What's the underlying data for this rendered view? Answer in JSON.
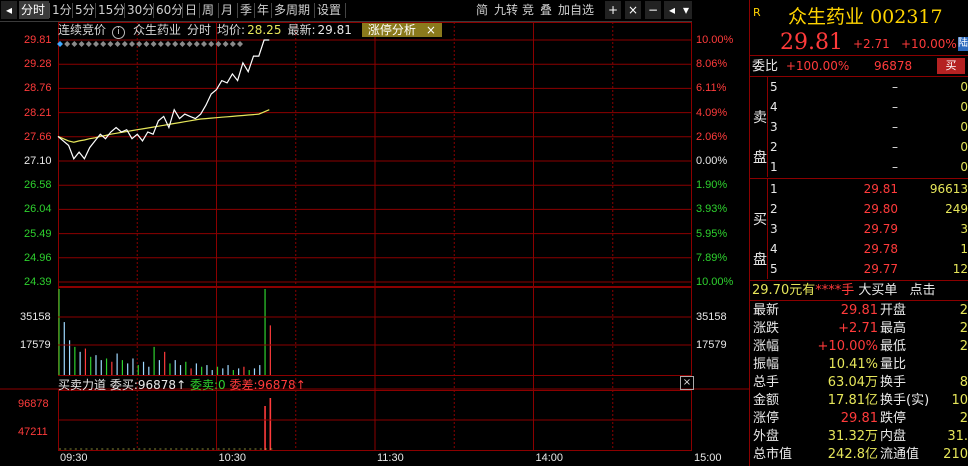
{
  "toolbar": {
    "periods": [
      {
        "label": "分时",
        "active": true
      },
      {
        "label": "1分",
        "active": false
      },
      {
        "label": "5分",
        "active": false
      },
      {
        "label": "15分",
        "active": false
      },
      {
        "label": "30分",
        "active": false
      },
      {
        "label": "60分",
        "active": false
      },
      {
        "label": "日",
        "active": false
      },
      {
        "label": "周",
        "active": false
      },
      {
        "label": "月",
        "active": false
      },
      {
        "label": "季",
        "active": false
      },
      {
        "label": "年",
        "active": false
      },
      {
        "label": "多周期",
        "active": false
      },
      {
        "label": "设置",
        "active": false
      }
    ],
    "right_buttons": [
      "简",
      "九转",
      "竞",
      "叠",
      "加自选"
    ],
    "controls": [
      "+",
      "×",
      "−"
    ]
  },
  "info_bar": {
    "auction_label": "连续竞价",
    "info_icon": "info-icon",
    "stock_name": "众生药业",
    "mode": "分时",
    "avg_label": "均价:",
    "avg_value": "28.25",
    "latest_label": "最新:",
    "latest_value": "29.81",
    "tag": "涨停分析",
    "tag_close": "×"
  },
  "price_axis": {
    "left": [
      "29.81",
      "29.28",
      "28.76",
      "28.21",
      "27.66",
      "27.10",
      "26.58",
      "26.04",
      "25.49",
      "24.96",
      "24.39"
    ],
    "right": [
      "10.00%",
      "8.06%",
      "6.11%",
      "4.09%",
      "2.06%",
      "0.00%",
      "1.90%",
      "3.93%",
      "5.95%",
      "7.89%",
      "10.00%"
    ]
  },
  "volume_axis": {
    "left": [
      "35158",
      "17579"
    ],
    "right": [
      "35158",
      "17579"
    ]
  },
  "force_panel": {
    "title": "买卖力道",
    "buy_label": "委买:",
    "buy_value": "96878↑",
    "sell_label": "委卖:",
    "sell_value": "0",
    "diff_label": "委差:",
    "diff_value": "96878↑",
    "close": "×",
    "axis": [
      "96878",
      "47211"
    ]
  },
  "time_axis": [
    "09:30",
    "10:30",
    "11:30",
    "14:00",
    "15:00"
  ],
  "chart_data": {
    "type": "line",
    "prev_close": 27.1,
    "price_times": [
      0,
      2,
      4,
      6,
      8,
      10,
      12,
      14,
      16,
      18,
      20,
      22,
      24,
      26,
      28,
      30,
      32,
      34,
      36,
      38,
      40,
      42,
      44,
      46,
      48,
      50,
      52,
      54,
      56,
      58,
      60,
      62,
      64,
      66,
      68,
      70,
      72,
      74,
      76,
      78,
      80
    ],
    "price": [
      27.65,
      27.55,
      27.45,
      27.15,
      27.3,
      27.15,
      27.4,
      27.55,
      27.7,
      27.6,
      27.75,
      27.85,
      27.75,
      27.8,
      27.6,
      27.7,
      27.55,
      27.75,
      27.7,
      28.0,
      28.1,
      27.85,
      28.25,
      28.05,
      28.15,
      28.1,
      28.05,
      28.15,
      28.35,
      28.6,
      28.7,
      28.9,
      28.85,
      29.05,
      28.9,
      29.3,
      29.1,
      29.45,
      29.45,
      29.81,
      29.81
    ],
    "avg": [
      27.65,
      27.6,
      27.55,
      27.52,
      27.55,
      27.57,
      27.6,
      27.62,
      27.65,
      27.67,
      27.7,
      27.72,
      27.74,
      27.76,
      27.78,
      27.8,
      27.82,
      27.84,
      27.86,
      27.88,
      27.9,
      27.92,
      27.94,
      27.96,
      27.98,
      28.0,
      28.02,
      28.04,
      28.05,
      28.06,
      28.07,
      28.08,
      28.09,
      28.1,
      28.11,
      28.12,
      28.13,
      28.14,
      28.15,
      28.2,
      28.25
    ],
    "volume_times": [
      0,
      2,
      4,
      6,
      8,
      10,
      12,
      14,
      16,
      18,
      20,
      22,
      24,
      26,
      28,
      30,
      32,
      34,
      36,
      38,
      40,
      42,
      44,
      46,
      48,
      50,
      52,
      54,
      56,
      58,
      60,
      62,
      64,
      66,
      68,
      70,
      72,
      74,
      76,
      78,
      80
    ],
    "volume": [
      52000,
      32000,
      21000,
      17000,
      14000,
      16000,
      11000,
      12000,
      9000,
      10000,
      8000,
      13000,
      9000,
      7000,
      10000,
      6000,
      8000,
      5000,
      17000,
      9000,
      14000,
      7000,
      9000,
      6000,
      8000,
      4000,
      7000,
      5000,
      6000,
      3000,
      5000,
      4000,
      6000,
      3000,
      4000,
      5000,
      3000,
      4000,
      6000,
      52000,
      30000
    ],
    "buy_force": [
      0,
      0,
      0,
      0,
      0,
      0,
      0,
      0,
      0,
      0,
      0,
      0,
      0,
      0,
      0,
      0,
      0,
      0,
      0,
      0,
      0,
      0,
      0,
      0,
      0,
      0,
      0,
      0,
      0,
      0,
      0,
      0,
      0,
      0,
      0,
      0,
      0,
      0,
      0,
      82000,
      96878
    ],
    "minutes_total": 240
  },
  "panel": {
    "badge": "R",
    "name": "众生药业",
    "code": "002317",
    "price": "29.81",
    "change": "+2.71",
    "change_pct": "+10.00%",
    "ratio_label": "委比",
    "ratio_value": "+100.00%",
    "ratio_diff": "96878",
    "buy_btn": "买",
    "sell_group": [
      "卖",
      "盘"
    ],
    "buy_group": [
      "买",
      "盘"
    ],
    "asks": [
      {
        "lvl": "5",
        "price": "–",
        "vol": "0"
      },
      {
        "lvl": "4",
        "price": "–",
        "vol": "0"
      },
      {
        "lvl": "3",
        "price": "–",
        "vol": "0"
      },
      {
        "lvl": "2",
        "price": "–",
        "vol": "0"
      },
      {
        "lvl": "1",
        "price": "–",
        "vol": "0"
      }
    ],
    "bids": [
      {
        "lvl": "1",
        "price": "29.81",
        "vol": "96613"
      },
      {
        "lvl": "2",
        "price": "29.80",
        "vol": "249"
      },
      {
        "lvl": "3",
        "price": "29.79",
        "vol": "3"
      },
      {
        "lvl": "4",
        "price": "29.78",
        "vol": "1"
      },
      {
        "lvl": "5",
        "price": "29.77",
        "vol": "12"
      }
    ],
    "bigorder": {
      "price": "29.70元有",
      "stars": "****手",
      "label": "大买单",
      "more": "点击"
    },
    "stats": [
      {
        "l": "最新",
        "v": "29.81",
        "l2": "开盘",
        "v2": "2"
      },
      {
        "l": "涨跌",
        "v": "+2.71",
        "l2": "最高",
        "v2": "2"
      },
      {
        "l": "涨幅",
        "v": "+10.00%",
        "l2": "最低",
        "v2": "2"
      },
      {
        "l": "振幅",
        "v": "10.41%",
        "l2": "量比",
        "v2": ""
      },
      {
        "l": "总手",
        "v": "63.04万",
        "l2": "换手",
        "v2": "8"
      },
      {
        "l": "金额",
        "v": "17.81亿",
        "l2": "换手(实)",
        "v2": "10"
      },
      {
        "l": "涨停",
        "v": "29.81",
        "l2": "跌停",
        "v2": "2"
      },
      {
        "l": "外盘",
        "v": "31.32万",
        "l2": "内盘",
        "v2": "31."
      },
      {
        "l": "总市值",
        "v": "242.8亿",
        "l2": "流通值",
        "v2": "210"
      }
    ]
  }
}
